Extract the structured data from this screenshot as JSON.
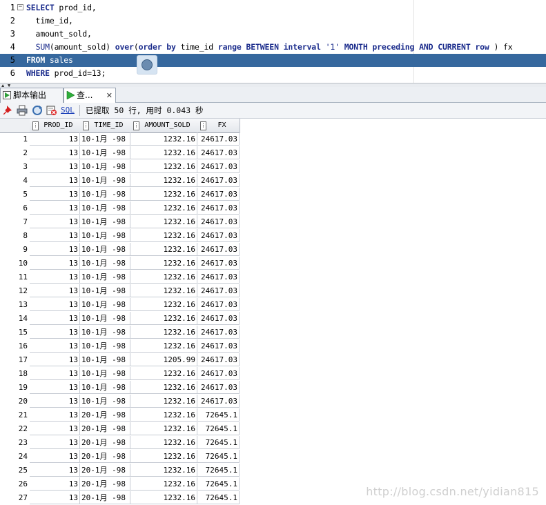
{
  "editor": {
    "lines": [
      {
        "num": "1",
        "parts": [
          {
            "t": "SELECT",
            "c": "kw"
          },
          {
            "t": " prod_id,",
            "c": "plain"
          }
        ]
      },
      {
        "num": "2",
        "parts": [
          {
            "t": "  time_id,",
            "c": "plain"
          }
        ]
      },
      {
        "num": "3",
        "parts": [
          {
            "t": "  amount_sold,",
            "c": "plain"
          }
        ]
      },
      {
        "num": "4",
        "parts": [
          {
            "t": "  ",
            "c": "plain"
          },
          {
            "t": "SUM",
            "c": "fn"
          },
          {
            "t": "(amount_sold) ",
            "c": "plain"
          },
          {
            "t": "over",
            "c": "kw"
          },
          {
            "t": "(",
            "c": "plain"
          },
          {
            "t": "order by",
            "c": "kw"
          },
          {
            "t": " time_id ",
            "c": "plain"
          },
          {
            "t": "range BETWEEN interval",
            "c": "kw"
          },
          {
            "t": " ",
            "c": "plain"
          },
          {
            "t": "'1'",
            "c": "str"
          },
          {
            "t": " ",
            "c": "plain"
          },
          {
            "t": "MONTH preceding AND CURRENT row",
            "c": "kw"
          },
          {
            "t": " ) fx",
            "c": "plain"
          }
        ]
      },
      {
        "num": "5",
        "parts": [
          {
            "t": "FROM",
            "c": "kw"
          },
          {
            "t": " sales",
            "c": "plain"
          }
        ]
      },
      {
        "num": "6",
        "parts": [
          {
            "t": "WHERE",
            "c": "kw"
          },
          {
            "t": " prod_id=13;",
            "c": "plain"
          }
        ]
      }
    ],
    "selected_line": "5"
  },
  "tabs": [
    {
      "label": "脚本输出",
      "active": false,
      "icon": "script-output-icon"
    },
    {
      "label": "查...",
      "active": true,
      "icon": "run-query-icon"
    }
  ],
  "toolbar": {
    "sql_label": "SQL",
    "status": "已提取 50 行, 用时 0.043 秒",
    "icons": [
      "pin-icon",
      "print-icon",
      "refresh-icon",
      "export-icon"
    ]
  },
  "grid": {
    "columns": [
      "PROD_ID",
      "TIME_ID",
      "AMOUNT_SOLD",
      "FX"
    ],
    "rows": [
      [
        "1",
        "13",
        "10-1月 -98",
        "1232.16",
        "24617.03"
      ],
      [
        "2",
        "13",
        "10-1月 -98",
        "1232.16",
        "24617.03"
      ],
      [
        "3",
        "13",
        "10-1月 -98",
        "1232.16",
        "24617.03"
      ],
      [
        "4",
        "13",
        "10-1月 -98",
        "1232.16",
        "24617.03"
      ],
      [
        "5",
        "13",
        "10-1月 -98",
        "1232.16",
        "24617.03"
      ],
      [
        "6",
        "13",
        "10-1月 -98",
        "1232.16",
        "24617.03"
      ],
      [
        "7",
        "13",
        "10-1月 -98",
        "1232.16",
        "24617.03"
      ],
      [
        "8",
        "13",
        "10-1月 -98",
        "1232.16",
        "24617.03"
      ],
      [
        "9",
        "13",
        "10-1月 -98",
        "1232.16",
        "24617.03"
      ],
      [
        "10",
        "13",
        "10-1月 -98",
        "1232.16",
        "24617.03"
      ],
      [
        "11",
        "13",
        "10-1月 -98",
        "1232.16",
        "24617.03"
      ],
      [
        "12",
        "13",
        "10-1月 -98",
        "1232.16",
        "24617.03"
      ],
      [
        "13",
        "13",
        "10-1月 -98",
        "1232.16",
        "24617.03"
      ],
      [
        "14",
        "13",
        "10-1月 -98",
        "1232.16",
        "24617.03"
      ],
      [
        "15",
        "13",
        "10-1月 -98",
        "1232.16",
        "24617.03"
      ],
      [
        "16",
        "13",
        "10-1月 -98",
        "1232.16",
        "24617.03"
      ],
      [
        "17",
        "13",
        "10-1月 -98",
        "1205.99",
        "24617.03"
      ],
      [
        "18",
        "13",
        "10-1月 -98",
        "1232.16",
        "24617.03"
      ],
      [
        "19",
        "13",
        "10-1月 -98",
        "1232.16",
        "24617.03"
      ],
      [
        "20",
        "13",
        "10-1月 -98",
        "1232.16",
        "24617.03"
      ],
      [
        "21",
        "13",
        "20-1月 -98",
        "1232.16",
        "72645.1"
      ],
      [
        "22",
        "13",
        "20-1月 -98",
        "1232.16",
        "72645.1"
      ],
      [
        "23",
        "13",
        "20-1月 -98",
        "1232.16",
        "72645.1"
      ],
      [
        "24",
        "13",
        "20-1月 -98",
        "1232.16",
        "72645.1"
      ],
      [
        "25",
        "13",
        "20-1月 -98",
        "1232.16",
        "72645.1"
      ],
      [
        "26",
        "13",
        "20-1月 -98",
        "1232.16",
        "72645.1"
      ],
      [
        "27",
        "13",
        "20-1月 -98",
        "1232.16",
        "72645.1"
      ]
    ]
  },
  "watermark": "http://blog.csdn.net/yidian815"
}
